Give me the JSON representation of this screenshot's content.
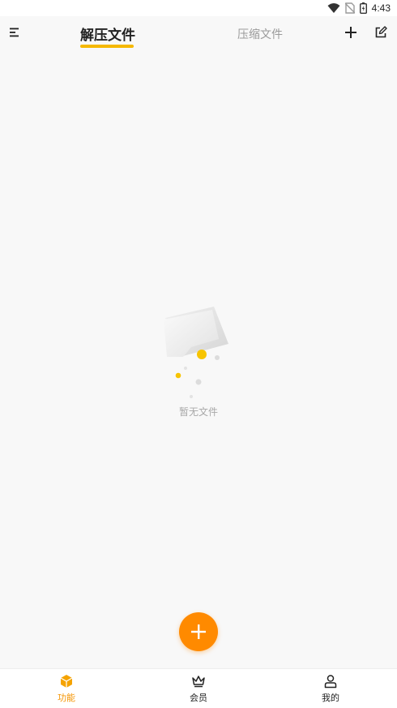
{
  "status_bar": {
    "time": "4:43"
  },
  "header": {
    "tabs": [
      {
        "label": "解压文件",
        "active": true
      },
      {
        "label": "压缩文件",
        "active": false
      }
    ]
  },
  "empty_state": {
    "message": "暂无文件"
  },
  "bottom_nav": {
    "items": [
      {
        "label": "功能",
        "icon": "box-icon",
        "active": true
      },
      {
        "label": "会员",
        "icon": "crown-icon",
        "active": false
      },
      {
        "label": "我的",
        "icon": "user-icon",
        "active": false
      }
    ]
  },
  "colors": {
    "accent": "#f5b800",
    "fab": "#ff8a00",
    "active_nav": "#f59400",
    "inactive_tab": "#9a9a9a"
  }
}
